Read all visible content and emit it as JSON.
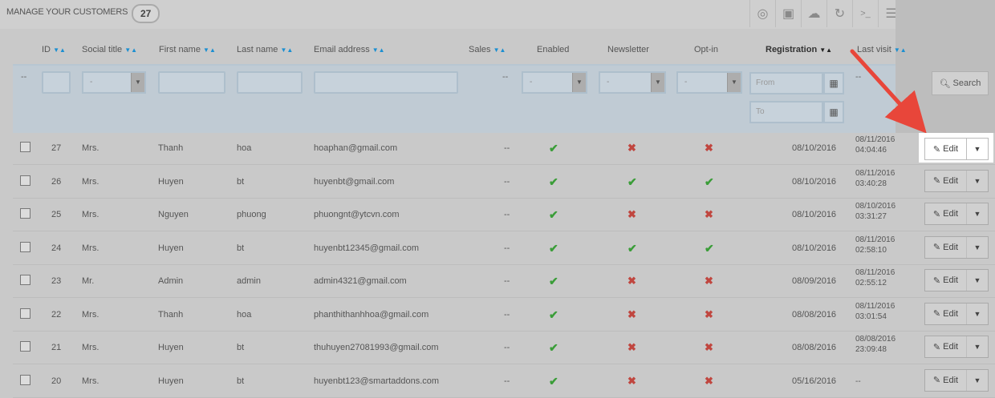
{
  "header": {
    "title": "MANAGE YOUR CUSTOMERS",
    "count": "27"
  },
  "toolbar": {
    "icons": [
      "add-circle-icon",
      "export-icon",
      "cloud-upload-icon",
      "refresh-icon",
      "sql-query-icon",
      "database-icon"
    ],
    "sql_label": ">_"
  },
  "columns": {
    "id": "ID",
    "social_title": "Social title",
    "first_name": "First name",
    "last_name": "Last name",
    "email": "Email address",
    "sales": "Sales",
    "enabled": "Enabled",
    "newsletter": "Newsletter",
    "optin": "Opt-in",
    "registration": "Registration",
    "last_visit": "Last visit"
  },
  "filters": {
    "dash": "--",
    "select_placeholder": "-",
    "from_placeholder": "From",
    "to_placeholder": "To",
    "search_label": "Search"
  },
  "rows": [
    {
      "id": "27",
      "title": "Mrs.",
      "first": "Thanh",
      "last": "hoa",
      "email": "hoaphan@gmail.com",
      "sales": "--",
      "enabled": true,
      "newsletter": false,
      "optin": false,
      "registration": "08/10/2016",
      "last_visit": [
        "08/11/2016",
        "04:04:46"
      ]
    },
    {
      "id": "26",
      "title": "Mrs.",
      "first": "Huyen",
      "last": "bt",
      "email": "huyenbt@gmail.com",
      "sales": "--",
      "enabled": true,
      "newsletter": true,
      "optin": true,
      "registration": "08/10/2016",
      "last_visit": [
        "08/11/2016",
        "03:40:28"
      ]
    },
    {
      "id": "25",
      "title": "Mrs.",
      "first": "Nguyen",
      "last": "phuong",
      "email": "phuongnt@ytcvn.com",
      "sales": "--",
      "enabled": true,
      "newsletter": false,
      "optin": false,
      "registration": "08/10/2016",
      "last_visit": [
        "08/10/2016",
        "03:31:27"
      ]
    },
    {
      "id": "24",
      "title": "Mrs.",
      "first": "Huyen",
      "last": "bt",
      "email": "huyenbt12345@gmail.com",
      "sales": "--",
      "enabled": true,
      "newsletter": true,
      "optin": true,
      "registration": "08/10/2016",
      "last_visit": [
        "08/11/2016",
        "02:58:10"
      ]
    },
    {
      "id": "23",
      "title": "Mr.",
      "first": "Admin",
      "last": "admin",
      "email": "admin4321@gmail.com",
      "sales": "--",
      "enabled": true,
      "newsletter": false,
      "optin": false,
      "registration": "08/09/2016",
      "last_visit": [
        "08/11/2016",
        "02:55:12"
      ]
    },
    {
      "id": "22",
      "title": "Mrs.",
      "first": "Thanh",
      "last": "hoa",
      "email": "phanthithanhhoa@gmail.com",
      "sales": "--",
      "enabled": true,
      "newsletter": false,
      "optin": false,
      "registration": "08/08/2016",
      "last_visit": [
        "08/11/2016",
        "03:01:54"
      ]
    },
    {
      "id": "21",
      "title": "Mrs.",
      "first": "Huyen",
      "last": "bt",
      "email": "thuhuyen27081993@gmail.com",
      "sales": "--",
      "enabled": true,
      "newsletter": false,
      "optin": false,
      "registration": "08/08/2016",
      "last_visit": [
        "08/08/2016",
        "23:09:48"
      ]
    },
    {
      "id": "20",
      "title": "Mrs.",
      "first": "Huyen",
      "last": "bt",
      "email": "huyenbt123@smartaddons.com",
      "sales": "--",
      "enabled": true,
      "newsletter": false,
      "optin": false,
      "registration": "05/16/2016",
      "last_visit": [
        "--",
        ""
      ]
    }
  ],
  "actions": {
    "edit_label": "Edit"
  },
  "colors": {
    "check": "#3a9d38",
    "cross": "#c0463f",
    "sort_arrow": "#1b8fd1",
    "annotation_arrow": "#e8463a"
  }
}
